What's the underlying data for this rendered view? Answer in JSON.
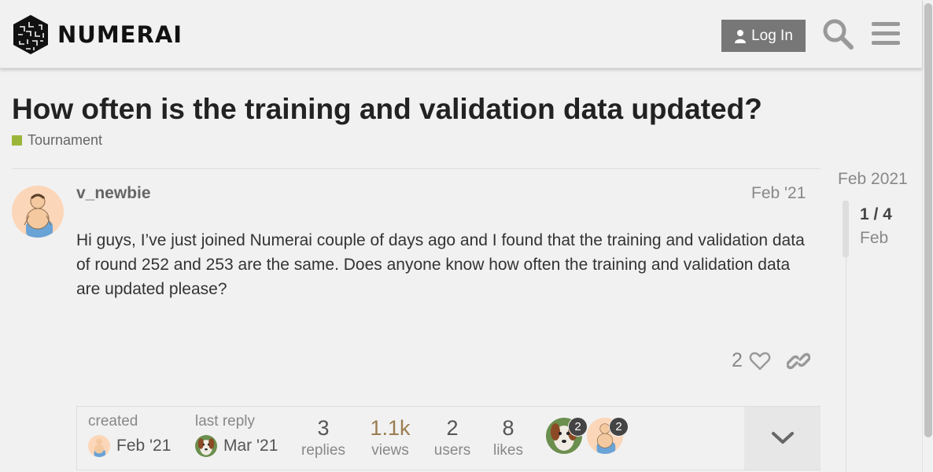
{
  "header": {
    "brand": "NUMERAI",
    "login_label": "Log In",
    "icons": {
      "search": "search-icon",
      "menu": "hamburger-menu-icon",
      "user": "user-icon"
    }
  },
  "topic": {
    "title": "How often is the training and validation data updated?",
    "category": {
      "label": "Tournament",
      "color": "#9ab638"
    }
  },
  "post": {
    "username": "v_newbie",
    "date": "Feb '21",
    "body": "Hi guys, I’ve just joined Numerai couple of days ago and I found that the training and validation data of round 252 and 253 are the same. Does anyone know how often the training and validation data are updated please?",
    "likes": "2"
  },
  "topic_map": {
    "created_label": "created",
    "created_date": "Feb '21",
    "last_reply_label": "last reply",
    "last_reply_date": "Mar '21",
    "stats": [
      {
        "num": "3",
        "label": "replies"
      },
      {
        "num": "1.1k",
        "label": "views"
      },
      {
        "num": "2",
        "label": "users"
      },
      {
        "num": "8",
        "label": "likes"
      }
    ],
    "participants": [
      {
        "name": "dog-avatar",
        "count": "2"
      },
      {
        "name": "v_newbie-avatar",
        "count": "2"
      }
    ]
  },
  "timeline": {
    "top_date": "Feb 2021",
    "position": "1 / 4",
    "current_date": "Feb"
  }
}
